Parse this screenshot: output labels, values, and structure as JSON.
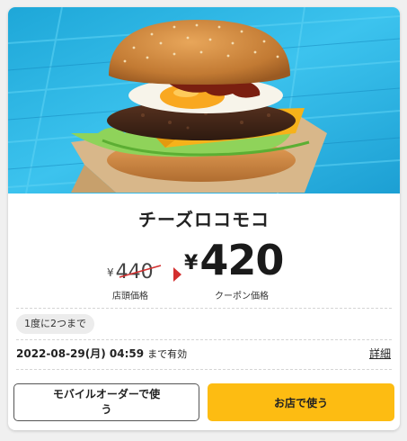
{
  "product": {
    "name": "チーズロコモコ",
    "image_icon": "burger-photo"
  },
  "price": {
    "yen_symbol": "¥",
    "original": "440",
    "original_caption": "店頭価格",
    "coupon": "420",
    "coupon_caption": "クーポン価格"
  },
  "limit_badge": "1度に2つまで",
  "expiry": {
    "datetime": "2022-08-29(月) 04:59",
    "suffix": "まで有効",
    "detail_link": "詳細"
  },
  "buttons": {
    "mobile_order": "モバイルオーダーで使う",
    "in_store": "お店で使う"
  },
  "colors": {
    "accent_yellow": "#fdbc12",
    "arrow_red": "#d32f2f",
    "background_blue": "#2bb6e3"
  }
}
